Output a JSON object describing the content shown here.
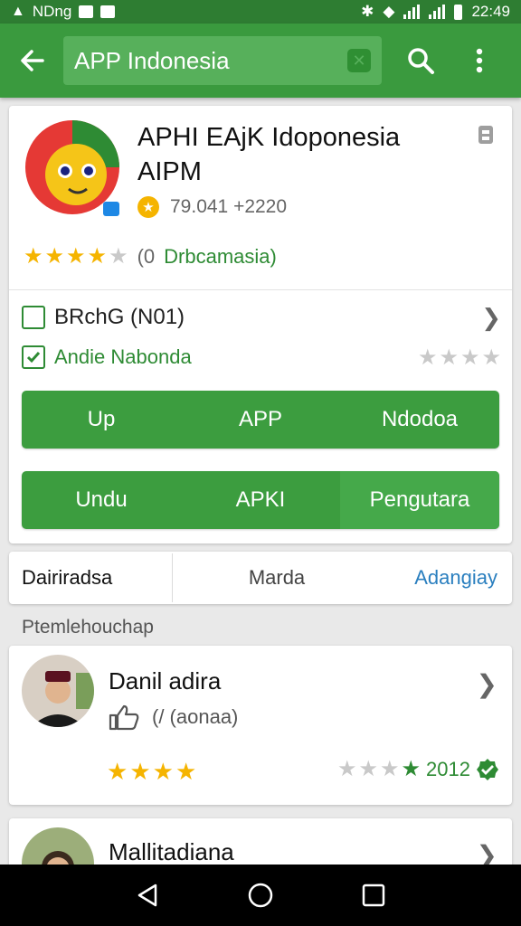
{
  "status_bar": {
    "carrier": "NDng",
    "time": "22:49"
  },
  "toolbar": {
    "search_value": "APP Indonesia"
  },
  "app": {
    "title_line1": "APHI EAjK Idoponesia",
    "title_line2": "AIPM",
    "meta_text": "79.041 +2220",
    "rating_count": "0",
    "rating_tag": "Drbcamasia)",
    "option1": "BRchG (N01)",
    "option2": "Andie Nabonda",
    "button1": [
      "Up",
      "APP",
      "Ndodoa"
    ],
    "button2": [
      "Undu",
      "APKI",
      "Pengutara"
    ]
  },
  "tabs": [
    "Dairiradsa",
    "Marda",
    "Adangiay"
  ],
  "section_label": "Ptemlehouchap",
  "reviews": [
    {
      "name": "Danil adira",
      "likes": "(/ (aonaa)",
      "date": "2012"
    },
    {
      "name": "Mallitadiana"
    }
  ],
  "colors": {
    "primary": "#3a9a3e",
    "primary_dark": "#2e7d32",
    "star": "#f5b400"
  },
  "icons": [
    "back-arrow-icon",
    "search-icon",
    "more-vert-icon",
    "pin-icon",
    "checkbox-icon",
    "chevron-right-icon",
    "thumb-up-icon",
    "verified-icon"
  ]
}
